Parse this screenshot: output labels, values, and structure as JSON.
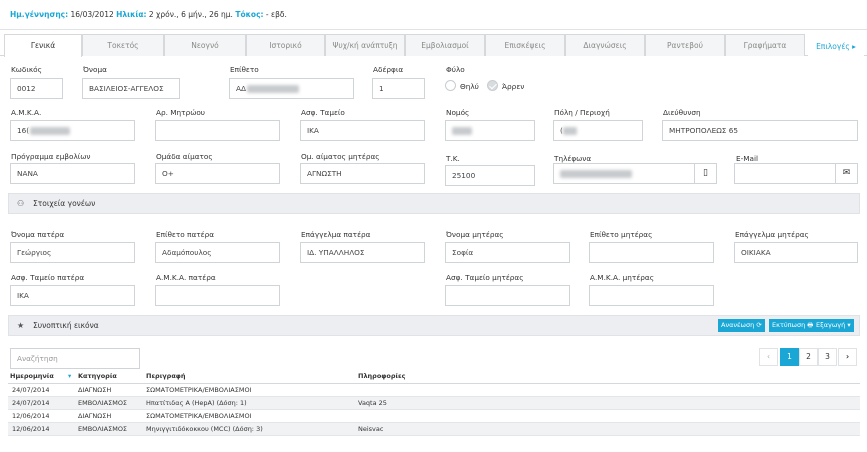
{
  "header": {
    "dob_label": "Ημ.γέννησης:",
    "dob_value": "16/03/2012",
    "age_label": "Ηλικία:",
    "age_value": "2 χρόν., 6 μήν., 26 ημ.",
    "birth_label": "Τόκος:",
    "birth_value": "- εβδ."
  },
  "tabs": [
    {
      "label": "Γενικά"
    },
    {
      "label": "Τοκετός"
    },
    {
      "label": "Νεογνό"
    },
    {
      "label": "Ιστορικό"
    },
    {
      "label": "Ψυχ/κή ανάπτυξη"
    },
    {
      "label": "Εμβολιασμοί"
    },
    {
      "label": "Επισκέψεις"
    },
    {
      "label": "Διαγνώσεις"
    },
    {
      "label": "Ραντεβού"
    },
    {
      "label": "Γραφήματα"
    }
  ],
  "options_label": "Επιλογές ▸",
  "form": {
    "code": {
      "label": "Κωδικός",
      "value": "0012"
    },
    "first_name": {
      "label": "Όνομα",
      "value": "ΒΑΣΙΛΕΙΟΣ-ΑΓΓΕΛΟΣ"
    },
    "last_name": {
      "label": "Επίθετο",
      "value": "ΑΔ"
    },
    "siblings": {
      "label": "Αδέρφια",
      "value": "1"
    },
    "gender": {
      "label": "Φύλο",
      "female": "Θηλύ",
      "male": "Άρρεν",
      "selected": "Άρρεν"
    },
    "amka": {
      "label": "Α.Μ.Κ.Α.",
      "value": "16("
    },
    "registry": {
      "label": "Αρ. Μητρώου",
      "value": ""
    },
    "insurance": {
      "label": "Ασφ. Ταμείο",
      "value": "ΙΚΑ"
    },
    "prefecture": {
      "label": "Νομός",
      "value": ""
    },
    "city": {
      "label": "Πόλη / Περιοχή",
      "value": "("
    },
    "address": {
      "label": "Διεύθυνση",
      "value": "ΜΗΤΡΟΠΟΛΕΩΣ 65"
    },
    "vaccine_program": {
      "label": "Πρόγραμμα εμβολίων",
      "value": "NANA"
    },
    "blood_group": {
      "label": "Ομάδα αίματος",
      "value": "O+"
    },
    "mother_blood": {
      "label": "Ομ. αίματος μητέρας",
      "value": "ΑΓΝΩΣΤΗ"
    },
    "postal": {
      "label": "Τ.Κ.",
      "value": "25100"
    },
    "phone": {
      "label": "Τηλέφωνα",
      "value": ""
    },
    "email": {
      "label": "E-Mail",
      "value": ""
    }
  },
  "parents_section": {
    "title": "Στοιχεία γονέων"
  },
  "parents": {
    "father_name": {
      "label": "Όνομα πατέρα",
      "value": "Γεώργιος"
    },
    "father_surname": {
      "label": "Επίθετο πατέρα",
      "value": "Αδαμόπουλος"
    },
    "father_job": {
      "label": "Επάγγελμα πατέρα",
      "value": "ΙΔ. ΥΠΑΛΛΗΛΟΣ"
    },
    "mother_name": {
      "label": "Όνομα μητέρας",
      "value": "Σοφία"
    },
    "mother_surname": {
      "label": "Επίθετο μητέρας",
      "value": ""
    },
    "mother_job": {
      "label": "Επάγγελμα μητέρας",
      "value": "ΟΙΚΙΑΚΑ"
    },
    "father_insurance": {
      "label": "Ασφ. Ταμείο πατέρα",
      "value": "ΙΚΑ"
    },
    "father_amka": {
      "label": "Α.Μ.Κ.Α. πατέρα",
      "value": ""
    },
    "mother_insurance": {
      "label": "Ασφ. Ταμείο μητέρας",
      "value": ""
    },
    "mother_amka": {
      "label": "Α.Μ.Κ.Α. μητέρας",
      "value": ""
    }
  },
  "summary_section": {
    "title": "Συνοπτική εικόνα",
    "refresh": "Ανανέωση ⟳",
    "print": "Εκτύπωση 🖶",
    "export": "Εξαγωγή ▾"
  },
  "search": {
    "placeholder": "Αναζήτηση"
  },
  "pagination": {
    "prev": "‹",
    "pages": [
      "1",
      "2",
      "3"
    ],
    "next": "›",
    "current": "1"
  },
  "table": {
    "headers": [
      "Ημερομηνία",
      "Κατηγορία",
      "Περιγραφή",
      "Πληροφορίες"
    ],
    "rows": [
      [
        "24/07/2014",
        "ΔΙΑΓΝΩΣΗ",
        "ΣΩΜΑΤΟΜΕΤΡΙΚΑ/ΕΜΒΟΛΙΑΣΜΟΙ",
        ""
      ],
      [
        "24/07/2014",
        "ΕΜΒΟΛΙΑΣΜΟΣ",
        "Ηπατίτιδας Α (HepA) (Δόση: 1)",
        "Vaqta 25"
      ],
      [
        "12/06/2014",
        "ΔΙΑΓΝΩΣΗ",
        "ΣΩΜΑΤΟΜΕΤΡΙΚΑ/ΕΜΒΟΛΙΑΣΜΟΙ",
        ""
      ],
      [
        "12/06/2014",
        "ΕΜΒΟΛΙΑΣΜΟΣ",
        "Μηνιγγιτιδόκοκκου (MCC) (Δόση: 3)",
        "Neisvac"
      ]
    ]
  }
}
